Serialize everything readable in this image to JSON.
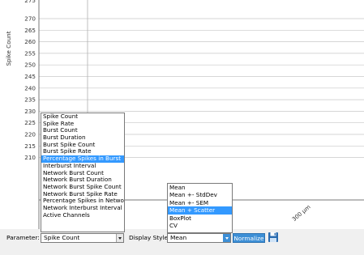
{
  "chart_data": {
    "type": "line",
    "ylabel": "Spike Count",
    "y_ticks": [
      "270",
      "265",
      "260",
      "255",
      "250",
      "245",
      "240",
      "235",
      "230",
      "225",
      "220",
      "215",
      "210"
    ],
    "x_ticks": [
      "300 µm"
    ],
    "grid": true
  },
  "parameter_list": {
    "items": [
      "Spike Count",
      "Spike Rate",
      "Burst Count",
      "Burst Duration",
      "Burst Spike Count",
      "Burst Spike Rate",
      "Percentage Spikes in Burst",
      "Interburst Interval",
      "Network Burst Count",
      "Network Burst Duration",
      "Network Burst Spike Count",
      "Network Burst Spike Rate",
      "Percentage Spikes in Network",
      "Network Interburst Interval",
      "Active Channels"
    ],
    "highlighted": "Percentage Spikes in Burst"
  },
  "style_list": {
    "items": [
      "Mean",
      "Mean +- StdDev",
      "Mean +- SEM",
      "Mean + Scatter",
      "BoxPlot",
      "CV"
    ],
    "highlighted": "Mean + Scatter"
  },
  "toolbar": {
    "parameter_label": "Parameter:",
    "parameter_value": "Spike Count",
    "style_label": "Display Style:",
    "style_value": "Mean",
    "normalize_label": "Normalize",
    "save_icon": "save-icon"
  },
  "colors": {
    "highlight": "#3399ff",
    "accent": "#3d8fd6"
  }
}
